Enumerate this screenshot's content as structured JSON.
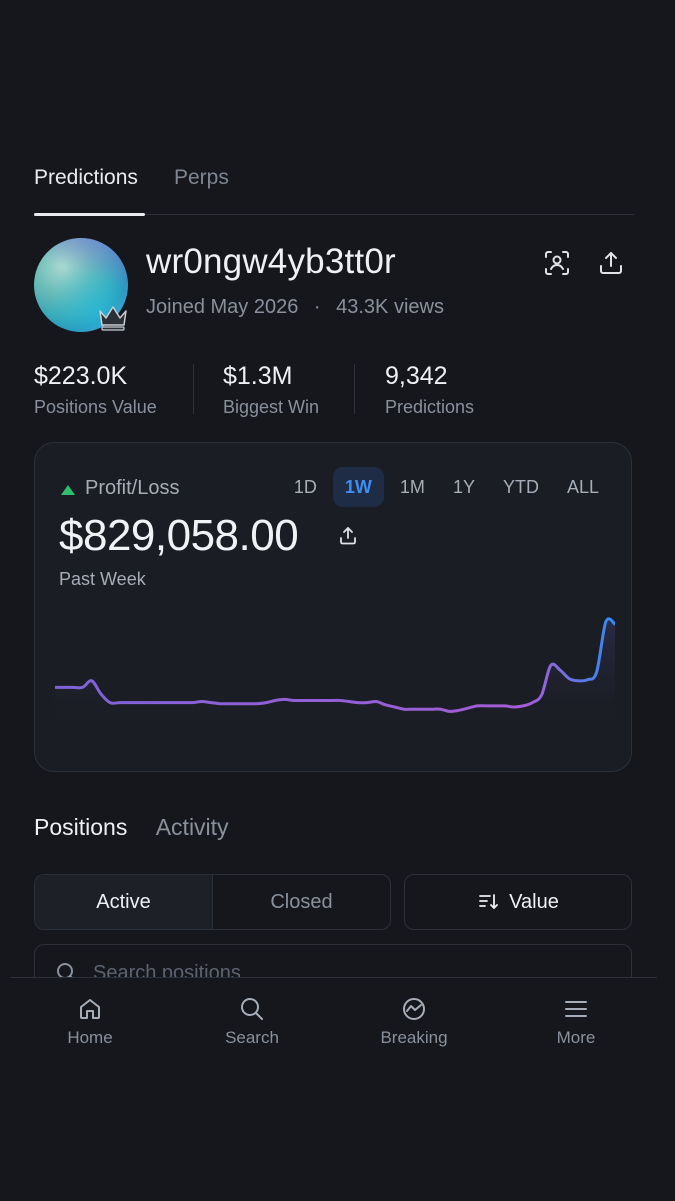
{
  "tabs": {
    "predictions": "Predictions",
    "perps": "Perps"
  },
  "profile": {
    "username": "wr0ngw4yb3tt0r",
    "joined": "Joined May 2026",
    "views": "43.3K views",
    "separator": "·"
  },
  "stats": [
    {
      "value": "$223.0K",
      "label": "Positions Value"
    },
    {
      "value": "$1.3M",
      "label": "Biggest Win"
    },
    {
      "value": "9,342",
      "label": "Predictions"
    }
  ],
  "pnl": {
    "label": "Profit/Loss",
    "value": "$829,058.00",
    "period": "Past Week",
    "trend_color": "#2fbf71",
    "ranges": [
      "1D",
      "1W",
      "1M",
      "1Y",
      "YTD",
      "ALL"
    ],
    "active_range": "1W"
  },
  "chart_data": {
    "type": "line",
    "title": "",
    "xlabel": "",
    "ylabel": "",
    "grid": false,
    "y": [
      40,
      40,
      40,
      40,
      46,
      34,
      26,
      26,
      26,
      26,
      26,
      26,
      26,
      26,
      26,
      26,
      27,
      26,
      25,
      25,
      25,
      25,
      25,
      26,
      28,
      29,
      28,
      28,
      28,
      28,
      28,
      28,
      27,
      26,
      26,
      27,
      24,
      22,
      20,
      20,
      20,
      20,
      20,
      18,
      19,
      21,
      23,
      23,
      23,
      23,
      22,
      23,
      26,
      33,
      60,
      56,
      48,
      46,
      47,
      54,
      100,
      98
    ],
    "ylim": [
      0,
      110
    ],
    "line_colors": [
      "#7e63d8",
      "#a45cd6",
      "#2f8df0"
    ]
  },
  "positions": {
    "tab_positions": "Positions",
    "tab_activity": "Activity",
    "seg_active": "Active",
    "seg_closed": "Closed",
    "sort_label": "Value",
    "search_placeholder": "Search positions"
  },
  "nav": [
    {
      "label": "Home",
      "icon": "home-icon"
    },
    {
      "label": "Search",
      "icon": "search-icon"
    },
    {
      "label": "Breaking",
      "icon": "breaking-icon"
    },
    {
      "label": "More",
      "icon": "menu-icon"
    }
  ]
}
